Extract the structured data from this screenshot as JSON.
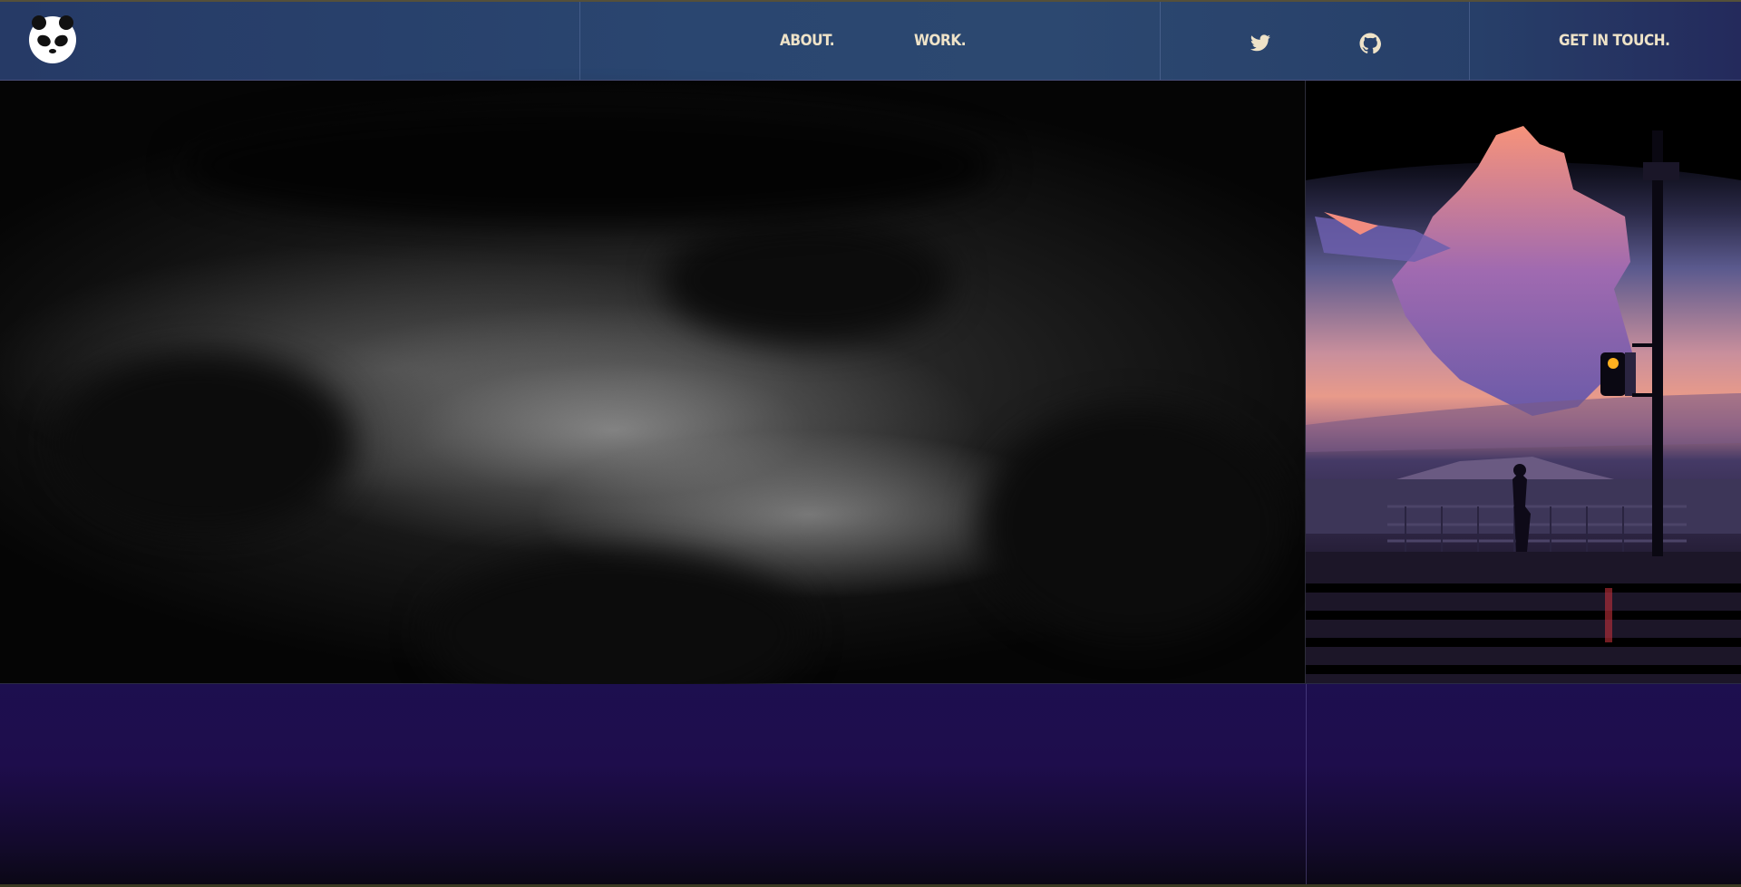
{
  "header": {
    "logo_icon": "panda-face-icon",
    "nav": [
      {
        "label": "ABOUT."
      },
      {
        "label": "WORK."
      }
    ],
    "social": [
      {
        "icon": "twitter-icon"
      },
      {
        "icon": "github-icon"
      }
    ],
    "cta_label": "GET IN TOUCH."
  },
  "hero": {
    "image": "monochrome cloudy night sky"
  },
  "artwork": {
    "image": "illustration of girl with guitar on pier at sunset with traffic light"
  },
  "colors": {
    "header": "#2a4670",
    "nav_text": "#efe3c8",
    "bottom": "#1e0d4c"
  }
}
